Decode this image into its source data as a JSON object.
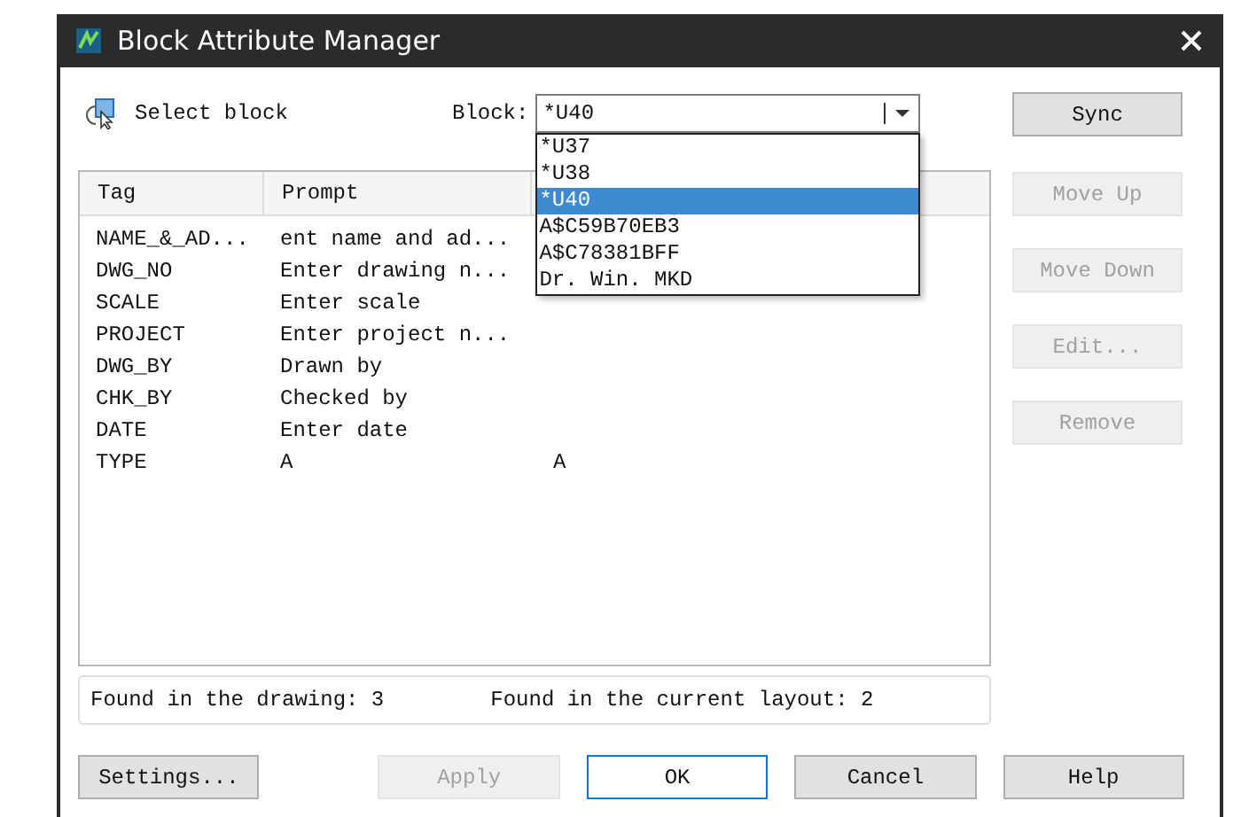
{
  "window": {
    "title": "Block Attribute Manager"
  },
  "select_block": {
    "label": "Select block"
  },
  "block_field": {
    "label": "Block:",
    "value": "*U40"
  },
  "dropdown": {
    "items": [
      {
        "label": "*U37",
        "selected": false
      },
      {
        "label": "*U38",
        "selected": false
      },
      {
        "label": "*U40",
        "selected": true
      },
      {
        "label": "A$C59B70EB3",
        "selected": false
      },
      {
        "label": "A$C78381BFF",
        "selected": false
      },
      {
        "label": "Dr. Win. MKD",
        "selected": false
      }
    ]
  },
  "table": {
    "columns": [
      "Tag",
      "Prompt"
    ],
    "rows": [
      {
        "tag": "NAME_&_AD...",
        "prompt": "ent name and ad..."
      },
      {
        "tag": "DWG_NO",
        "prompt": "Enter drawing n..."
      },
      {
        "tag": "SCALE",
        "prompt": "Enter scale"
      },
      {
        "tag": "PROJECT",
        "prompt": "Enter project n..."
      },
      {
        "tag": "DWG_BY",
        "prompt": "Drawn by"
      },
      {
        "tag": "CHK_BY",
        "prompt": "Checked by"
      },
      {
        "tag": "DATE",
        "prompt": "Enter date"
      },
      {
        "tag": "TYPE",
        "prompt": "A",
        "column_3": "A"
      }
    ]
  },
  "side_buttons": [
    {
      "label": "Sync",
      "disabled": false
    },
    {
      "label": "Move Up",
      "disabled": true
    },
    {
      "label": "Move Down",
      "disabled": true
    },
    {
      "label": "Edit...",
      "disabled": true
    },
    {
      "label": "Remove",
      "disabled": true
    }
  ],
  "status": {
    "found_in_drawing": "Found in the drawing: 3",
    "found_in_layout": "Found in the current layout: 2"
  },
  "bottom_buttons": [
    {
      "label": "Settings...",
      "disabled": false,
      "default": false
    },
    {
      "label": "Apply",
      "disabled": true,
      "default": false
    },
    {
      "label": "OK",
      "disabled": false,
      "default": true
    },
    {
      "label": "Cancel",
      "disabled": false,
      "default": false
    },
    {
      "label": "Help",
      "disabled": false,
      "default": false
    }
  ]
}
